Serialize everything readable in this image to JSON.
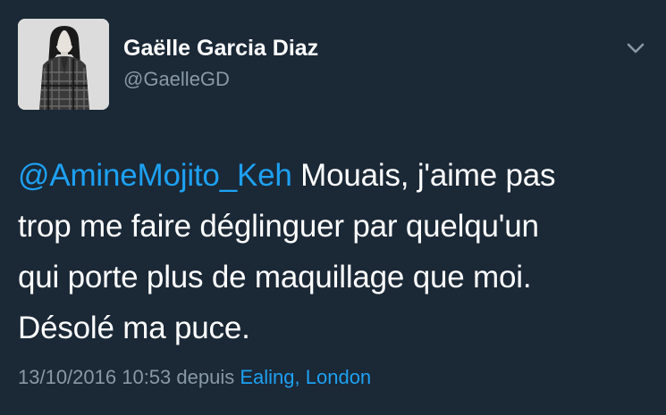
{
  "author": {
    "display_name": "Gaëlle Garcia Diaz",
    "handle": "@GaelleGD",
    "avatar": "profile-photo"
  },
  "menu": {
    "icon": "chevron-down-icon"
  },
  "tweet": {
    "mention": "@AmineMojito_Keh",
    "line1_rest": " Mouais, j'aime pas",
    "line2": "trop me faire déglinguer par quelqu'un",
    "line3": "qui porte plus de maquillage que moi.",
    "line4": "Désolé ma puce."
  },
  "meta": {
    "timestamp": "13/10/2016 10:53",
    "via": "depuis",
    "location": "Ealing, London"
  },
  "colors": {
    "background": "#1b2836",
    "text": "#ffffff",
    "secondary": "#8899a6",
    "link": "#1da1f2"
  }
}
